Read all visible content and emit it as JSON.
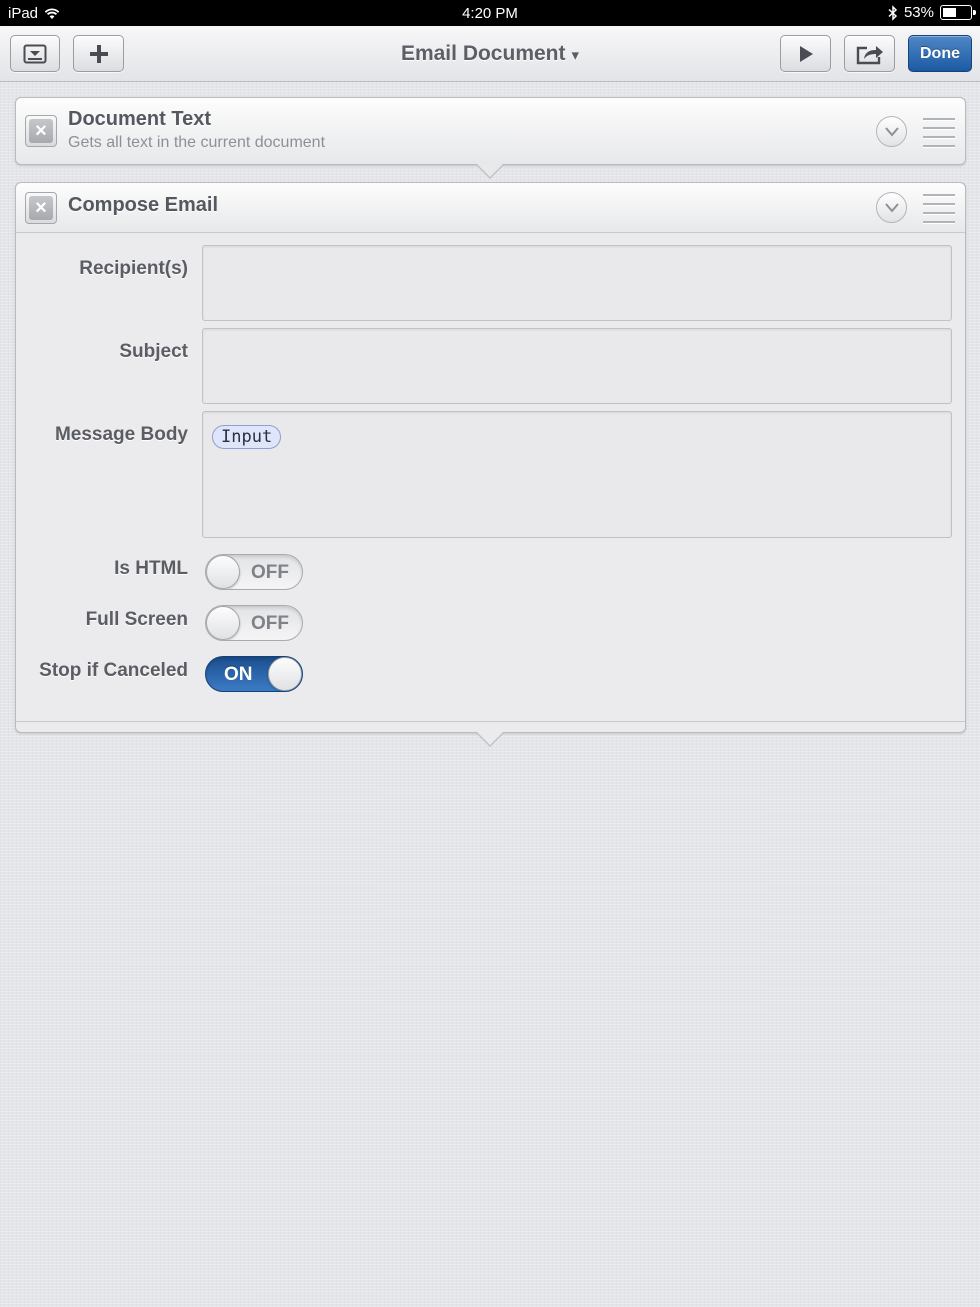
{
  "status_bar": {
    "device": "iPad",
    "time": "4:20 PM",
    "battery": "53%",
    "battery_level": 0.53
  },
  "toolbar": {
    "title": "Email Document",
    "title_caret": "▾",
    "done_label": "Done"
  },
  "actions": [
    {
      "title": "Document Text",
      "subtitle": "Gets all text in the current document"
    },
    {
      "title": "Compose Email",
      "fields": {
        "recipients_label": "Recipient(s)",
        "recipients_value": "",
        "subject_label": "Subject",
        "subject_value": "",
        "message_body_label": "Message Body",
        "message_body_token": "Input"
      },
      "toggles": [
        {
          "label": "Is HTML",
          "state": "OFF"
        },
        {
          "label": "Full Screen",
          "state": "OFF"
        },
        {
          "label": "Stop if Canceled",
          "state": "ON"
        }
      ]
    }
  ],
  "colors": {
    "accent": "#1b5aa3",
    "token_border": "#8e9fd0",
    "token_fill": "#dfe6fb"
  }
}
